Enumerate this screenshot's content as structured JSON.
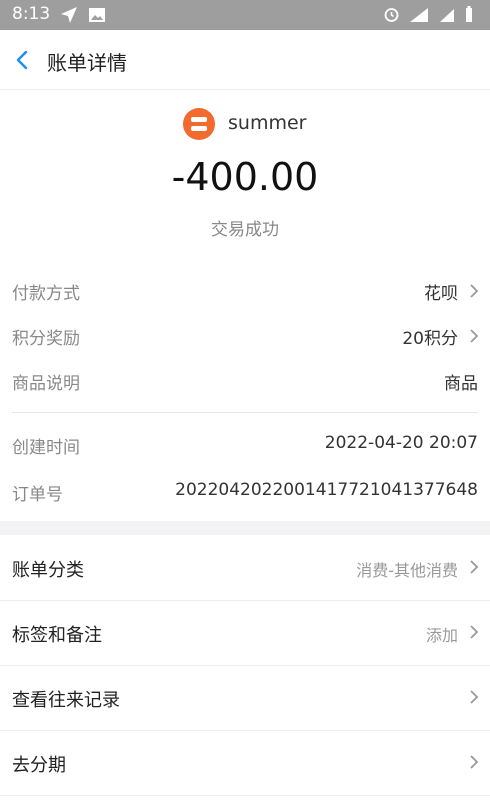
{
  "status_bar": {
    "time": "8:13"
  },
  "nav": {
    "title": "账单详情"
  },
  "merchant": {
    "name": "summer"
  },
  "amount": "-400.00",
  "status": "交易成功",
  "details": [
    {
      "label": "付款方式",
      "value": "花呗"
    },
    {
      "label": "积分奖励",
      "value": "20积分"
    },
    {
      "label": "商品说明",
      "value": "商品"
    }
  ],
  "meta": [
    {
      "label": "创建时间",
      "value": "2022-04-20 20:07"
    },
    {
      "label": "订单号",
      "value": "2022042022001417721041377648"
    }
  ],
  "actions": [
    {
      "label": "账单分类",
      "value": "消费-其他消费"
    },
    {
      "label": "标签和备注",
      "value": "添加"
    },
    {
      "label": "查看往来记录",
      "value": ""
    },
    {
      "label": "去分期",
      "value": ""
    }
  ],
  "colors": {
    "accent": "#1a8cff",
    "merchant_logo": "#f26a2e",
    "status_bar": "#9e9e9e"
  }
}
